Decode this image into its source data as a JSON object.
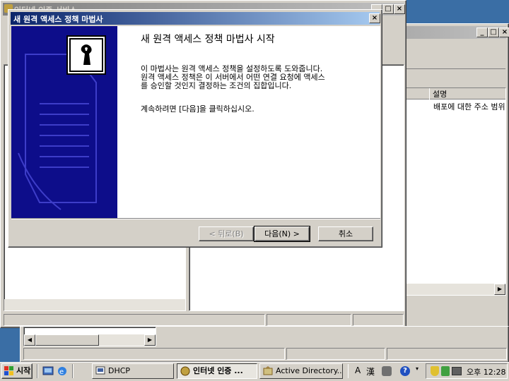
{
  "bg_window": {
    "title": "인터넷 인증 서비스",
    "column_header": "설명",
    "cell": "배포에 대한 주소 범위"
  },
  "wizard": {
    "title": "새 원격 액세스 정책 마법사",
    "heading": "새 원격 액세스 정책 마법사 시작",
    "para_line1": "이 마법사는 원격 액세스 정책을 설정하도록 도와줍니다.",
    "para_line2": "원격 액세스 정책은 이 서버에서 어떤 연결 요청에 액세스",
    "para_line3": "를 승인할 것인지 결정하는 조건의 집합입니다.",
    "continue_text": "계속하려면 [다음]을 클릭하십시오.",
    "back_button": "< 뒤로(B)",
    "next_button": "다음(N) >",
    "cancel_button": "취소",
    "close_glyph": "×"
  },
  "taskbar": {
    "start": "시작",
    "tasks": [
      {
        "label": "DHCP"
      },
      {
        "label": "인터넷 인증 ..."
      },
      {
        "label": "Active Directory..."
      }
    ],
    "ime_a": "A",
    "ime_han": "漢",
    "clock_ampm": "오후",
    "clock_time": "12:28"
  },
  "colors": {
    "desktop": "#3a6ea5",
    "title_active": "#0a246a",
    "wizard_banner": "#0d0d8a"
  }
}
